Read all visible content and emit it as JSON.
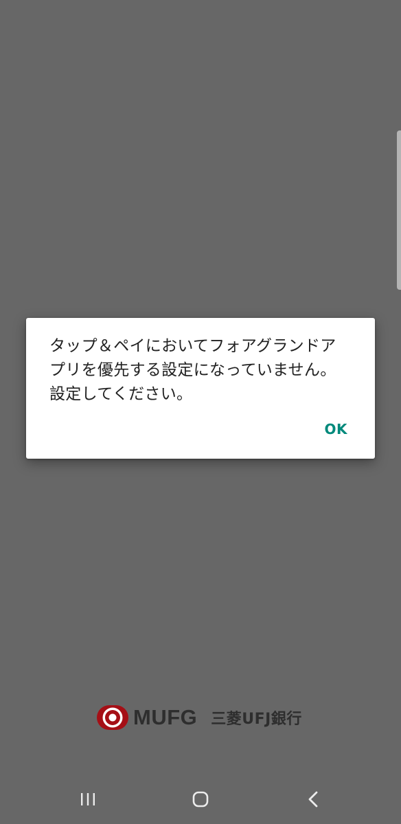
{
  "dialog": {
    "message": "タップ＆ペイにおいてフォアグランドア\nプリを優先する設定になっていません。\n設定してください。",
    "ok_label": "OK"
  },
  "branding": {
    "logo_text": "MUFG",
    "bank_name": "三菱UFJ銀行"
  },
  "colors": {
    "background": "#676767",
    "dialog": "#ffffff",
    "accent": "#00897b",
    "logo_red": "#a50f16"
  },
  "navigation": {
    "recents_icon": "recents-icon",
    "home_icon": "home-icon",
    "back_icon": "back-icon"
  }
}
